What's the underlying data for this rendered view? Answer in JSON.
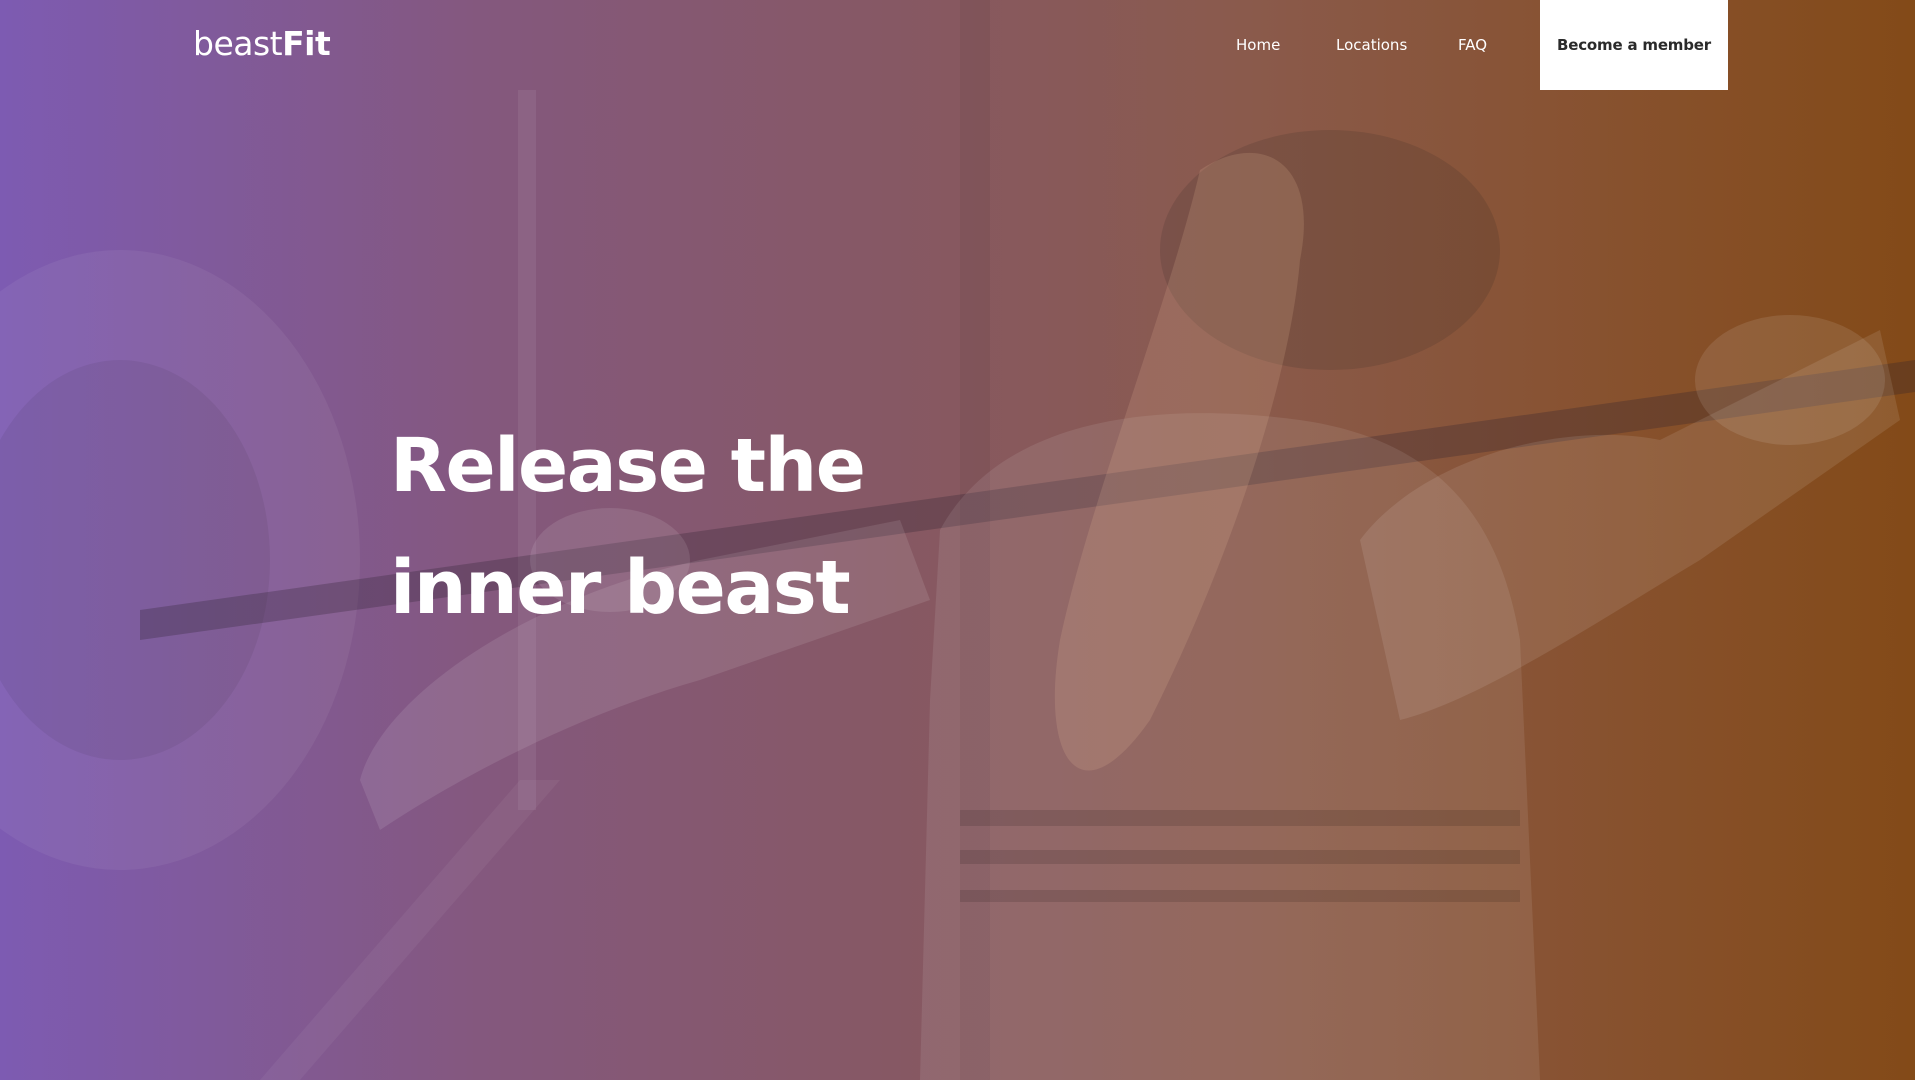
{
  "brand": {
    "name_light": "beast",
    "name_bold": "Fit"
  },
  "nav": {
    "items": [
      {
        "label": "Home"
      },
      {
        "label": "Locations"
      },
      {
        "label": "FAQ"
      }
    ],
    "cta_label": "Become a member"
  },
  "hero": {
    "headline_line1": "Release the",
    "headline_line2": "inner beast",
    "background_image": "woman-lifting-barbell-photo"
  },
  "colors": {
    "gradient_left": "#7d5bb2",
    "gradient_right": "#834a18",
    "text": "#ffffff",
    "cta_bg": "#ffffff",
    "cta_text": "#2a2a2a"
  }
}
